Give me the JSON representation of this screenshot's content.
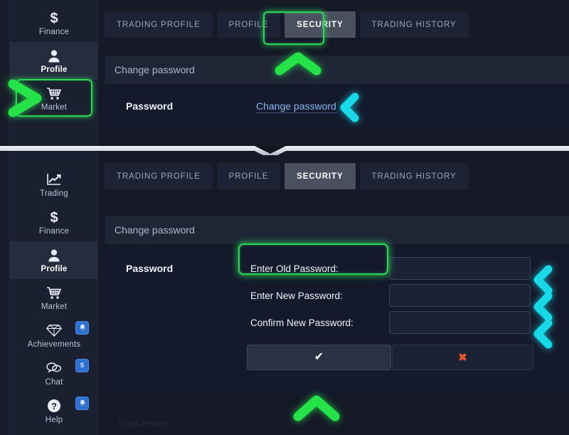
{
  "app": {
    "sidebar_items": [
      {
        "label": "Trading",
        "icon": "chart-line-icon",
        "badge": null,
        "active": false
      },
      {
        "label": "Finance",
        "icon": "dollar-icon",
        "badge": null,
        "active": false
      },
      {
        "label": "Profile",
        "icon": "user-icon",
        "badge": null,
        "active": true
      },
      {
        "label": "Market",
        "icon": "cart-icon",
        "badge": null,
        "active": false
      },
      {
        "label": "Achievements",
        "icon": "diamond-icon",
        "badge": "bell",
        "active": false
      },
      {
        "label": "Chat",
        "icon": "chat-icon",
        "badge": "5",
        "active": false
      },
      {
        "label": "Help",
        "icon": "question-icon",
        "badge": "bell",
        "active": false
      }
    ],
    "tabs": [
      {
        "label": "TRADING PROFILE",
        "active": false
      },
      {
        "label": "PROFILE",
        "active": false
      },
      {
        "label": "SECURITY",
        "active": true
      },
      {
        "label": "TRADING HISTORY",
        "active": false
      }
    ],
    "section_title": "Change password",
    "row_label": "Password",
    "change_password_link": "Change password",
    "form": {
      "fields": [
        {
          "label": "Enter Old Password:",
          "value": "",
          "placeholder": ""
        },
        {
          "label": "Enter New Password:",
          "value": "",
          "placeholder": ""
        },
        {
          "label": "Confirm New Password:",
          "value": "",
          "placeholder": ""
        }
      ],
      "confirm_glyph": "✔",
      "cancel_glyph": "✖"
    },
    "footer_faint_text": "Login History"
  },
  "annotations": {
    "profile_highlight_color": "#2bd656",
    "security_highlight_color": "#2bd656",
    "confirm_highlight_color": "#2bd656",
    "pointer_green_color": "#25e249",
    "pointer_cyan_color": "#17d9e8"
  }
}
